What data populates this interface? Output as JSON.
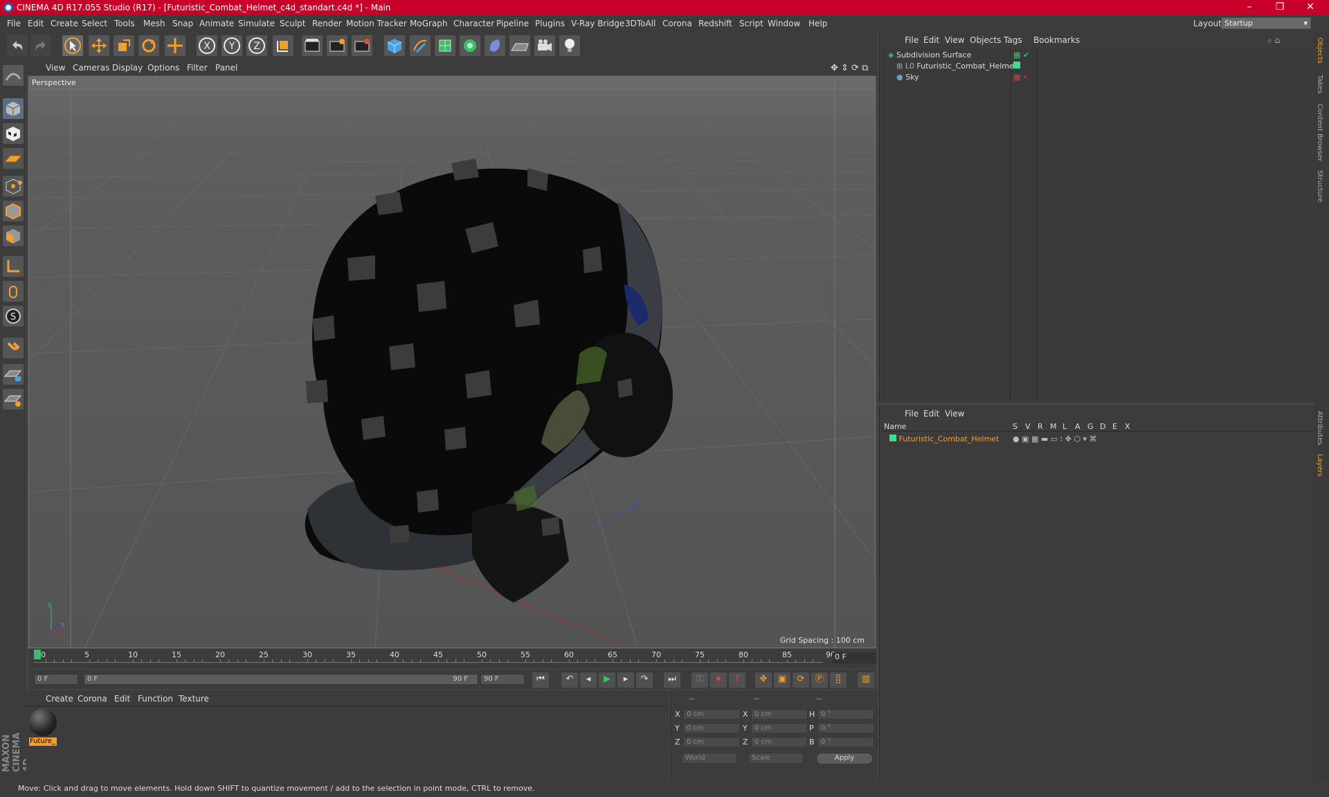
{
  "window": {
    "title": "CINEMA 4D R17.055 Studio (R17) - [Futuristic_Combat_Helmet_c4d_standart.c4d *] - Main"
  },
  "menu": [
    "File",
    "Edit",
    "Create",
    "Select",
    "Tools",
    "Mesh",
    "Snap",
    "Animate",
    "Simulate",
    "Sculpt",
    "Render",
    "Motion Tracker",
    "MoGraph",
    "Character",
    "Pipeline",
    "Plugins",
    "V-Ray Bridge",
    "3DToAll",
    "Corona",
    "Redshift",
    "Script",
    "Window",
    "Help"
  ],
  "layout": {
    "label": "Layout:",
    "value": "Startup"
  },
  "viewport": {
    "menu": [
      "View",
      "Cameras",
      "Display",
      "Options",
      "Filter",
      "Panel"
    ],
    "label": "Perspective",
    "grid_spacing": "Grid Spacing : 100 cm"
  },
  "timeline": {
    "ticks": [
      "0",
      "5",
      "10",
      "15",
      "20",
      "25",
      "30",
      "35",
      "40",
      "45",
      "50",
      "55",
      "60",
      "65",
      "70",
      "75",
      "80",
      "85",
      "90"
    ],
    "current_frame": "0 F",
    "start_field": "0 F",
    "range_start": "0 F",
    "range_end": "90 F",
    "end_field": "90 F"
  },
  "materials": {
    "menu": [
      "Create",
      "Corona",
      "Edit",
      "Function",
      "Texture"
    ],
    "items": [
      {
        "label": "Future_"
      }
    ]
  },
  "coords": {
    "header": [
      "--",
      "--",
      "--"
    ],
    "rows": [
      {
        "a": "X",
        "av": "0 cm",
        "b": "X",
        "bv": "0 cm",
        "c": "H",
        "cv": "0 °"
      },
      {
        "a": "Y",
        "av": "0 cm",
        "b": "Y",
        "bv": "0 cm",
        "c": "P",
        "cv": "0 °"
      },
      {
        "a": "Z",
        "av": "0 cm",
        "b": "Z",
        "bv": "0 cm",
        "c": "B",
        "cv": "0 °"
      }
    ],
    "world": "World",
    "scale": "Scale",
    "apply": "Apply"
  },
  "objects": {
    "menu": [
      "File",
      "Edit",
      "View",
      "Objects",
      "Tags",
      "Bookmarks"
    ],
    "items": [
      "Subdivision Surface",
      "Futuristic_Combat_Helmet",
      "Sky"
    ]
  },
  "layers": {
    "menu": [
      "File",
      "Edit",
      "View"
    ],
    "columns": [
      "Name",
      "S",
      "V",
      "R",
      "M",
      "L",
      "A",
      "G",
      "D",
      "E",
      "X"
    ],
    "items": [
      "Futuristic_Combat_Helmet"
    ]
  },
  "right_tabs": [
    "Objects",
    "Takes",
    "Content Browser",
    "Structure",
    "Attributes",
    "Layers"
  ],
  "brand": "MAXON CINEMA 4D",
  "status": "Move: Click and drag to move elements. Hold down SHIFT to quantize movement / add to the selection in point mode, CTRL to remove.",
  "colors": {
    "title_bar": "#c8002a",
    "accent": "#f0a030",
    "layer_color": "#3ddc97"
  }
}
